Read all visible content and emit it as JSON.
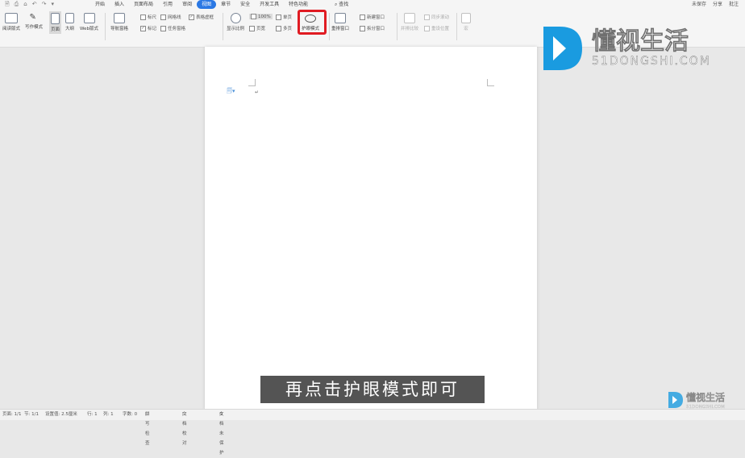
{
  "menu": {
    "items": [
      "开始",
      "插入",
      "页面布局",
      "引用",
      "审阅",
      "视图",
      "章节",
      "安全",
      "开发工具",
      "特色功能"
    ],
    "search": "查找",
    "right": [
      "未保存",
      "分享",
      "批注"
    ]
  },
  "ribbon": {
    "read_mode": "阅读版式",
    "write_mode": "写作模式",
    "page_view": "页面",
    "outline": "大纲",
    "web_layout": "Web版式",
    "nav_pane": "导航窗格",
    "ruler": "标尺",
    "gridlines": "网格线",
    "table_lines": "表格虚框",
    "markup": "标记",
    "task_pane": "任务窗格",
    "zoom": "显示比例",
    "zoom_value": "100%",
    "page_width": "页宽",
    "single_page": "单页",
    "multi_page": "多页",
    "eye_protection": "护眼模式",
    "rearrange": "重排窗口",
    "new_window": "新建窗口",
    "split_window": "拆分窗口",
    "side_by_side": "并排比较",
    "sync_scroll": "同步滚动",
    "reset_position": "重设位置",
    "macro": "宏"
  },
  "logo": {
    "name": "懂视生活",
    "domain": "51DONGSHI.COM"
  },
  "subtitle": "再点击护眼模式即可",
  "status": {
    "page": "页面: 1/1",
    "section": "节: 1/1",
    "position": "设置值: 2.5厘米",
    "row": "行: 1",
    "col": "列: 1",
    "words": "字数: 0",
    "spell": "拼写检查",
    "doc_check": "文档校对",
    "protect": "文档未保护"
  },
  "colors": {
    "accent": "#2b78e4",
    "highlight": "#e01b22",
    "logo_blue": "#1a9be0"
  }
}
